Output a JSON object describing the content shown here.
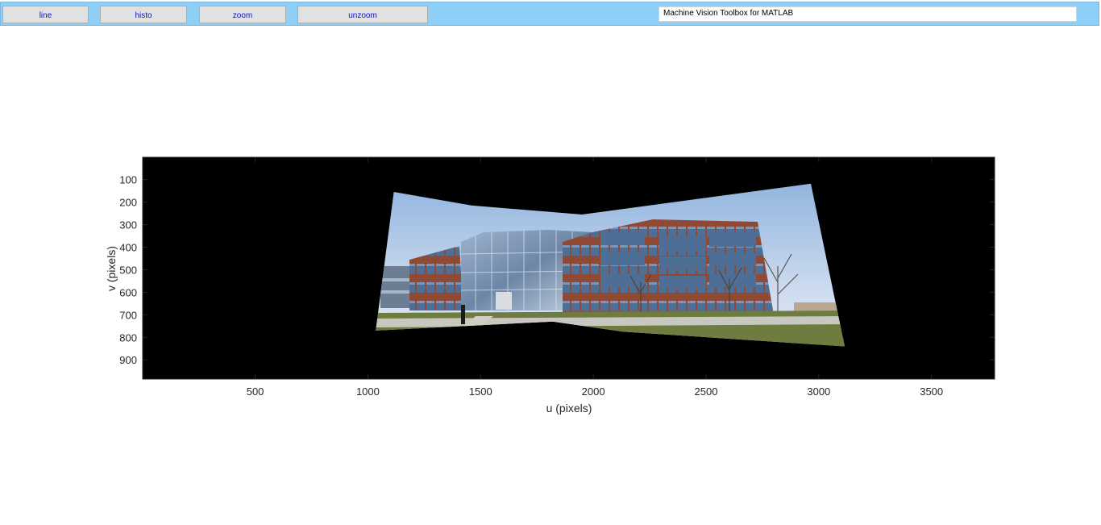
{
  "toolbar": {
    "buttons": [
      {
        "label": "line"
      },
      {
        "label": "histo"
      },
      {
        "label": "zoom"
      },
      {
        "label": "unzoom"
      }
    ],
    "status_text": "Machine Vision Toolbox for MATLAB",
    "background_color": "#8ecff8"
  },
  "chart_data": {
    "type": "image",
    "content": "stitched panoramic photo of a four-storey brick office building with glass curtain wall, on black background",
    "xlabel": "u (pixels)",
    "ylabel": "v (pixels)",
    "xlim": [
      1,
      3780
    ],
    "ylim": [
      1,
      985
    ],
    "y_reversed": true,
    "x_ticks": [
      500,
      1000,
      1500,
      2000,
      2500,
      3000,
      3500
    ],
    "y_ticks": [
      100,
      200,
      300,
      400,
      500,
      600,
      700,
      800,
      900
    ],
    "panorama_outline": [
      [
        1115,
        155
      ],
      [
        1460,
        215
      ],
      [
        1950,
        255
      ],
      [
        2965,
        118
      ],
      [
        3115,
        840
      ],
      [
        2130,
        775
      ],
      [
        1820,
        730
      ],
      [
        1035,
        770
      ]
    ]
  }
}
